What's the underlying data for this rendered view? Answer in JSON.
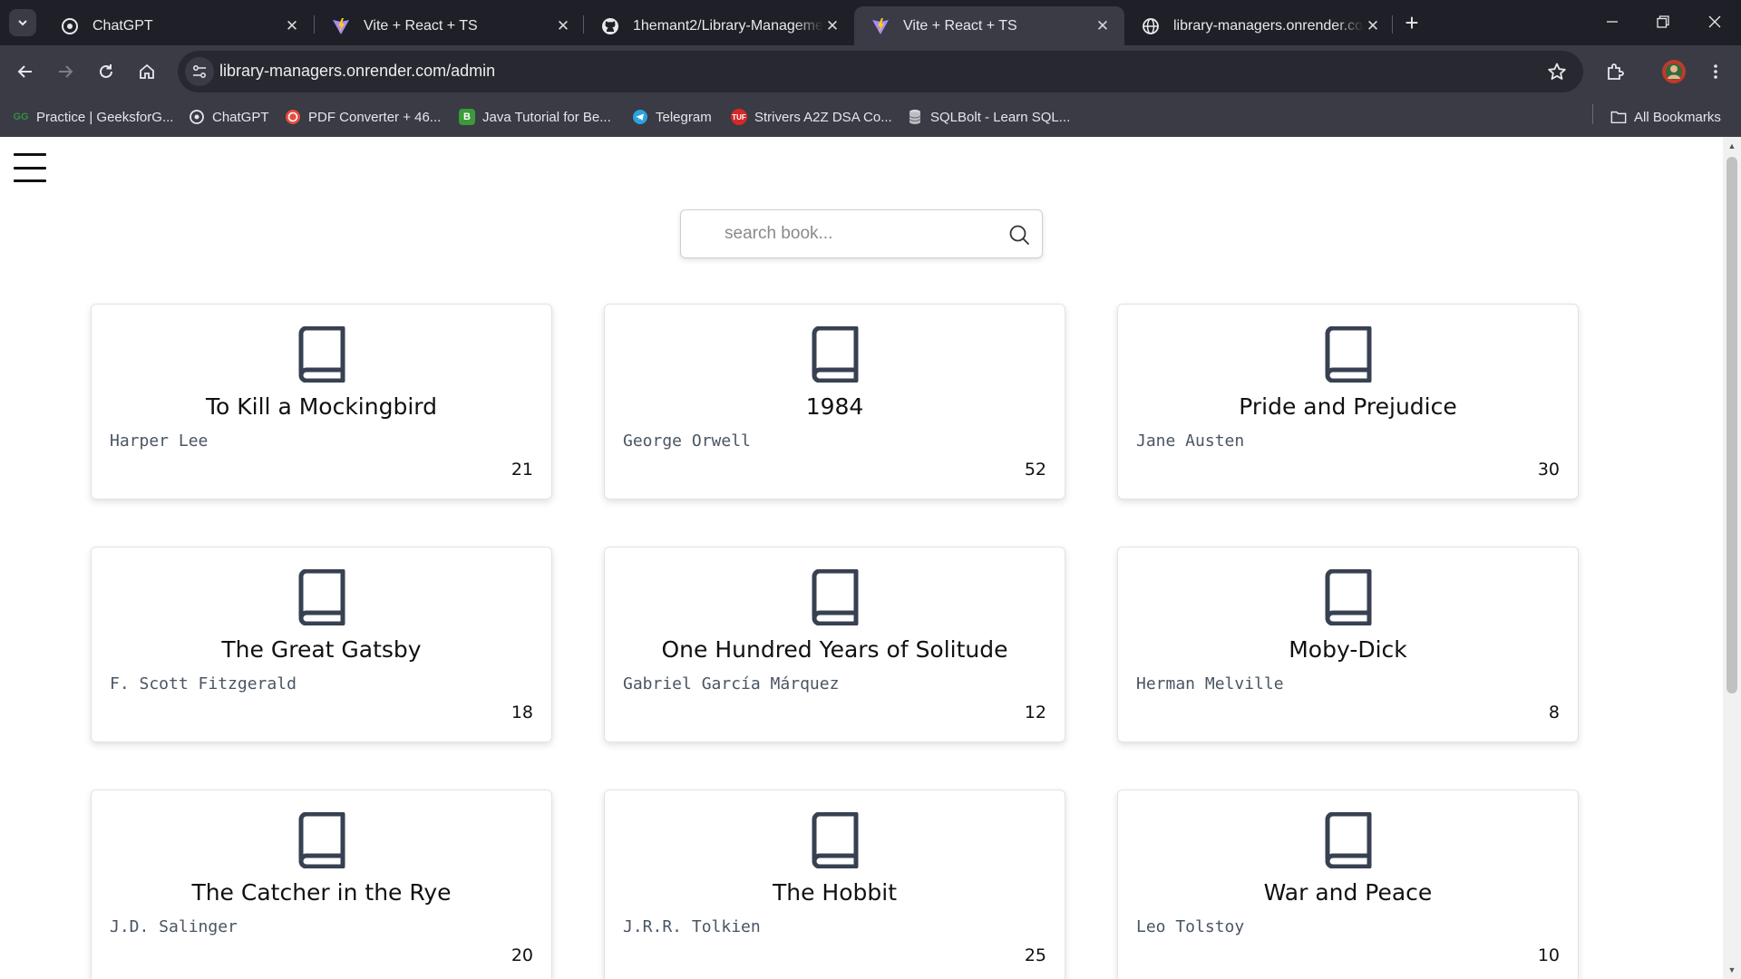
{
  "browser": {
    "tabs": [
      {
        "title": "ChatGPT",
        "icon": "openai-icon",
        "active": false
      },
      {
        "title": "Vite + React + TS",
        "icon": "vite-icon",
        "active": false
      },
      {
        "title": "1hemant2/Library-Management",
        "icon": "github-icon",
        "active": false
      },
      {
        "title": "Vite + React + TS",
        "icon": "vite-icon",
        "active": true
      },
      {
        "title": "library-managers.onrender.com",
        "icon": "globe-icon",
        "active": false
      }
    ],
    "url": "library-managers.onrender.com/admin",
    "bookmarks": [
      {
        "label": "Practice | GeeksforG...",
        "icon": "gfg-icon"
      },
      {
        "label": "ChatGPT",
        "icon": "openai-icon"
      },
      {
        "label": "PDF Converter + 46...",
        "icon": "pdf-converter-icon"
      },
      {
        "label": "Java Tutorial for Be...",
        "icon": "bookmark-b-icon"
      },
      {
        "label": "Telegram",
        "icon": "telegram-icon"
      },
      {
        "label": "Strivers A2Z DSA Co...",
        "icon": "tuf-icon"
      },
      {
        "label": "SQLBolt - Learn SQL...",
        "icon": "database-icon"
      }
    ],
    "all_bookmarks_label": "All Bookmarks",
    "colors": {
      "chrome_dark": "#1f2027",
      "chrome": "#3a3b44",
      "omnibox": "#282930"
    }
  },
  "page": {
    "search": {
      "placeholder": "search book..."
    },
    "books": [
      {
        "title": "To Kill a Mockingbird",
        "author": "Harper Lee",
        "count": "21"
      },
      {
        "title": "1984",
        "author": "George Orwell",
        "count": "52"
      },
      {
        "title": "Pride and Prejudice",
        "author": "Jane Austen",
        "count": "30"
      },
      {
        "title": "The Great Gatsby",
        "author": "F. Scott Fitzgerald",
        "count": "18"
      },
      {
        "title": "One Hundred Years of Solitude",
        "author": "Gabriel García Márquez",
        "count": "12"
      },
      {
        "title": "Moby-Dick",
        "author": "Herman Melville",
        "count": "8"
      },
      {
        "title": "The Catcher in the Rye",
        "author": "J.D. Salinger",
        "count": "20"
      },
      {
        "title": "The Hobbit",
        "author": "J.R.R. Tolkien",
        "count": "25"
      },
      {
        "title": "War and Peace",
        "author": "Leo Tolstoy",
        "count": "10"
      }
    ],
    "icon_color": "#374151"
  }
}
